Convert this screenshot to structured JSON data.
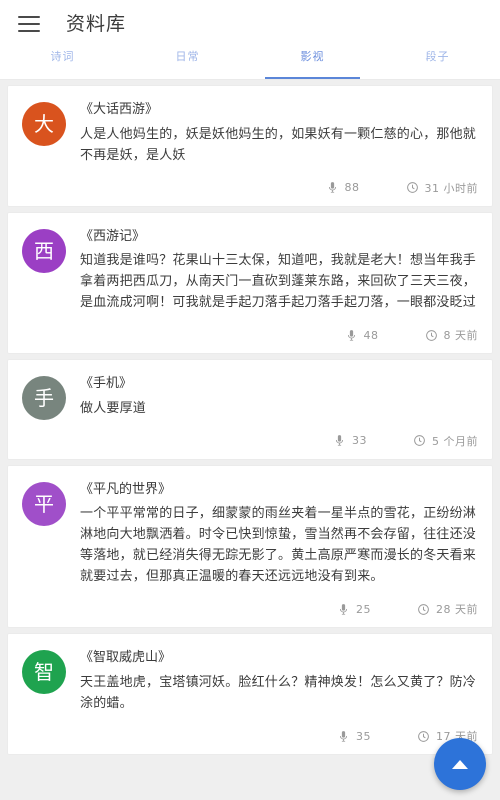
{
  "appbar": {
    "menu_icon": "hamburger-menu-icon",
    "title": "资料库"
  },
  "tabs": [
    {
      "label": "诗词",
      "active": false
    },
    {
      "label": "日常",
      "active": false
    },
    {
      "label": "影视",
      "active": true
    },
    {
      "label": "段子",
      "active": false
    }
  ],
  "colors": {
    "accent": "#5B86D8",
    "tab_inactive": "#9FB6E8",
    "tab_active": "#6E90DE",
    "fab": "#2D73D9",
    "page_background": "#EFEFEF",
    "card_background": "#FFFFFF"
  },
  "cards": [
    {
      "avatar_letter": "大",
      "avatar_color": "#D9531E",
      "title": "《大话西游》",
      "body": "人是人他妈生的，妖是妖他妈生的，如果妖有一颗仁慈的心，那他就不再是妖，是人妖",
      "play_icon": "microphone-icon",
      "play_count": "88",
      "time_icon": "clock-icon",
      "time_text": "31 小时前"
    },
    {
      "avatar_letter": "西",
      "avatar_color": "#9B3FC4",
      "title": "《西游记》",
      "body": "知道我是谁吗？花果山十三太保，知道吧，我就是老大！想当年我手拿着两把西瓜刀，从南天门一直砍到蓬莱东路，来回砍了三天三夜，是血流成河啊！可我就是手起刀落手起刀落手起刀落，一眼都没眨过",
      "play_icon": "microphone-icon",
      "play_count": "48",
      "time_icon": "clock-icon",
      "time_text": "8 天前"
    },
    {
      "avatar_letter": "手",
      "avatar_color": "#78857E",
      "title": "《手机》",
      "body": "做人要厚道",
      "play_icon": "microphone-icon",
      "play_count": "33",
      "time_icon": "clock-icon",
      "time_text": "5 个月前"
    },
    {
      "avatar_letter": "平",
      "avatar_color": "#A04FC9",
      "title": "《平凡的世界》",
      "body": "一个平平常常的日子，细蒙蒙的雨丝夹着一星半点的雪花，正纷纷淋淋地向大地飘洒着。时令已快到惊蛰，雪当然再不会存留，往往还没等落地，就已经消失得无踪无影了。黄土高原严寒而漫长的冬天看来就要过去，但那真正温暖的春天还远远地没有到来。",
      "play_icon": "microphone-icon",
      "play_count": "25",
      "time_icon": "clock-icon",
      "time_text": "28 天前"
    },
    {
      "avatar_letter": "智",
      "avatar_color": "#1FA34F",
      "title": "《智取威虎山》",
      "body": "天王盖地虎，宝塔镇河妖。脸红什么？精神焕发！怎么又黄了？防冷涂的蜡。",
      "play_icon": "microphone-icon",
      "play_count": "35",
      "time_icon": "clock-icon",
      "time_text": "17 天前"
    }
  ],
  "fab": {
    "icon": "scroll-to-top-arrow-icon",
    "label": "回到顶部"
  }
}
